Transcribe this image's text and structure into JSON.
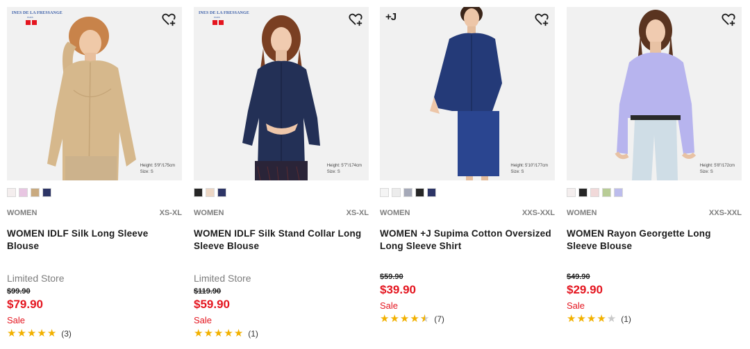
{
  "products": [
    {
      "brand": "ines",
      "brand_text": "INES DE LA FRESSANGE",
      "brand_sub": "PARIS",
      "height_line1": "Height: 5'9\"/175cm",
      "height_line2": "Size: S",
      "colors": [
        "#f4eeee",
        "#e8c6e2",
        "#c9aa80",
        "#2d3566"
      ],
      "gender": "WOMEN",
      "sizes": "XS-XL",
      "name": "WOMEN IDLF Silk Long Sleeve Blouse",
      "store": "Limited Store",
      "old_price": "$99.90",
      "price": "$79.90",
      "sale": "Sale",
      "rating": 5,
      "review_count": "(3)"
    },
    {
      "brand": "ines",
      "brand_text": "INES DE LA FRESSANGE",
      "brand_sub": "PARIS",
      "height_line1": "Height: 5'7\"/174cm",
      "height_line2": "Size: S",
      "colors": [
        "#262626",
        "#ecd6c4",
        "#2d3566"
      ],
      "gender": "WOMEN",
      "sizes": "XS-XL",
      "name": "WOMEN IDLF Silk Stand Collar Long Sleeve Blouse",
      "store": "Limited Store",
      "old_price": "$119.90",
      "price": "$59.90",
      "sale": "Sale",
      "rating": 5,
      "review_count": "(1)"
    },
    {
      "brand": "plusj",
      "brand_text": "+J",
      "height_line1": "Height: 5'10\"/177cm",
      "height_line2": "Size: S",
      "colors": [
        "#f4f4f4",
        "#ececec",
        "#a5a9b8",
        "#262626",
        "#2d3566"
      ],
      "gender": "WOMEN",
      "sizes": "XXS-XXL",
      "name": "WOMEN +J Supima Cotton Oversized Long Sleeve Shirt",
      "store": "",
      "old_price": "$59.90",
      "price": "$39.90",
      "sale": "Sale",
      "rating": 4.5,
      "review_count": "(7)"
    },
    {
      "brand": "none",
      "height_line1": "Height: 5'8\"/172cm",
      "height_line2": "Size: S",
      "colors": [
        "#f4eeee",
        "#262626",
        "#f1d9d9",
        "#b8cc96",
        "#bcbcec"
      ],
      "gender": "WOMEN",
      "sizes": "XXS-XXL",
      "name": "WOMEN Rayon Georgette Long Sleeve Blouse",
      "store": "",
      "old_price": "$49.90",
      "price": "$29.90",
      "sale": "Sale",
      "rating": 4,
      "review_count": "(1)"
    }
  ],
  "colors": {
    "sale_red": "#e4151f",
    "star": "#f2b100",
    "muted_text": "#7d7d7d"
  },
  "icons": {
    "favorite": "heart-plus-icon",
    "star": "star-icon"
  }
}
